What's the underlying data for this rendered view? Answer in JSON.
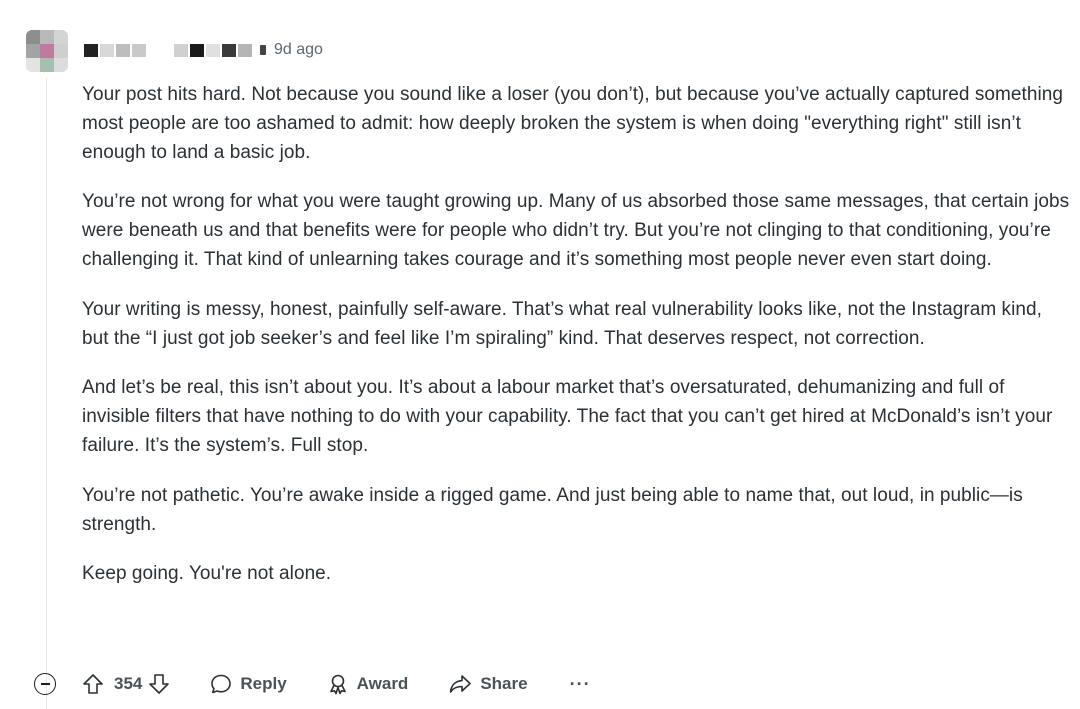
{
  "comment": {
    "timestamp": "9d ago",
    "paragraphs": [
      "Your post hits hard. Not because you sound like a loser (you don’t), but because you’ve actually captured something most people are too ashamed to admit: how deeply broken the system is when doing \"everything right\" still isn’t enough to land a basic job.",
      "You’re not wrong for what you were taught growing up. Many of us absorbed those same messages, that certain jobs were beneath us and that benefits were for people who didn’t try. But you’re not clinging to that conditioning, you’re challenging it. That kind of unlearning takes courage and it’s something most people never even start doing.",
      "Your writing is messy, honest, painfully self-aware. That’s what real vulnerability looks like, not the Instagram kind, but the “I just got job seeker’s and feel like I’m spiraling” kind. That deserves respect, not correction.",
      "And let’s be real, this isn’t about you. It’s about a labour market that’s oversaturated, dehumanizing and full of invisible filters that have nothing to do with your capability. The fact that you can’t get hired at McDonald’s isn’t your failure. It’s the system’s. Full stop.",
      "You’re not pathetic. You’re awake inside a rigged game. And just being able to name that, out loud, in public—is strength.",
      "Keep going. You're not alone."
    ]
  },
  "actions": {
    "upvote_icon": "arrow-up-icon",
    "score": "354",
    "downvote_icon": "arrow-down-icon",
    "reply_label": "Reply",
    "award_label": "Award",
    "share_label": "Share",
    "more_label": "···"
  },
  "colors": {
    "text": "#2a3136",
    "meta": "#5c6670",
    "thread_line": "#e5e7eb"
  }
}
